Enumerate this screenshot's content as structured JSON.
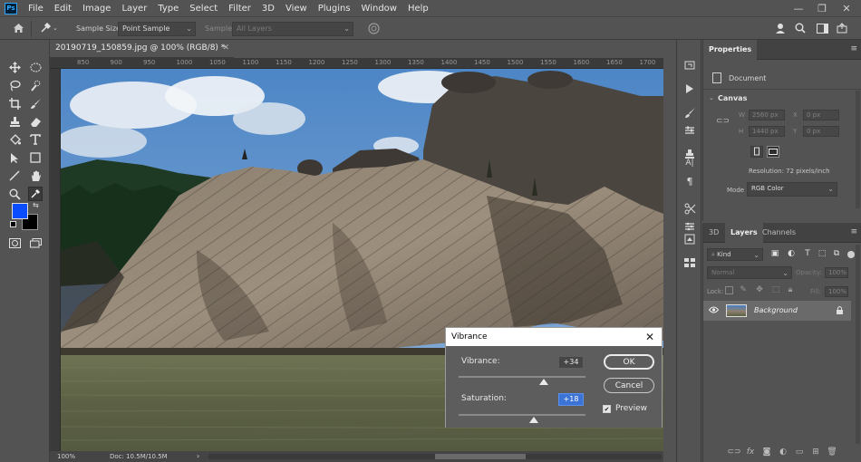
{
  "app": {
    "logo": "Ps",
    "menu": [
      "File",
      "Edit",
      "Image",
      "Layer",
      "Type",
      "Select",
      "Filter",
      "3D",
      "View",
      "Plugins",
      "Window",
      "Help"
    ],
    "window_controls": [
      "—",
      "❐",
      "✕"
    ]
  },
  "options_bar": {
    "sample_size_label": "Sample Size:",
    "sample_size_value": "Point Sample",
    "sample_label": "Sample:",
    "sample_value": "All Layers"
  },
  "document": {
    "tab_title": "20190719_150859.jpg @ 100% (RGB/8) *",
    "ruler_ticks": [
      "850",
      "900",
      "950",
      "1000",
      "1050",
      "1100",
      "1150",
      "1200",
      "1250",
      "1300",
      "1350",
      "1400",
      "1450",
      "1500",
      "1550",
      "1600",
      "1650",
      "1700"
    ],
    "zoom": "100%",
    "doc_info": "Doc: 10.5M/10.5M"
  },
  "properties": {
    "tab": "Properties",
    "type_label": "Document",
    "section": "Canvas",
    "w_label": "W",
    "w_value": "2560 px",
    "h_label": "H",
    "h_value": "1440 px",
    "x_label": "X",
    "x_value": "0 px",
    "y_label": "Y",
    "y_value": "0 px",
    "resolution": "Resolution: 72 pixels/inch",
    "mode_label": "Mode",
    "mode_value": "RGB Color"
  },
  "layers": {
    "tabs": [
      "3D",
      "Layers",
      "Channels"
    ],
    "kind_label": "Kind",
    "blend_mode": "Normal",
    "opacity_label": "Opacity:",
    "opacity_value": "100%",
    "lock_label": "Lock:",
    "fill_label": "Fill:",
    "fill_value": "100%",
    "layer_name": "Background"
  },
  "vibrance_dialog": {
    "title": "Vibrance",
    "close": "✕",
    "vibrance_label": "Vibrance:",
    "vibrance_value": "+34",
    "saturation_label": "Saturation:",
    "saturation_value": "+18",
    "ok_label": "OK",
    "cancel_label": "Cancel",
    "preview_label": "Preview",
    "preview_checked": true,
    "vibrance_amount": 34,
    "saturation_amount": 18
  },
  "colors": {
    "foreground": "#0a4cff",
    "background": "#000000",
    "ui_panel": "#535353",
    "dialog_body": "#5d5d5d"
  }
}
